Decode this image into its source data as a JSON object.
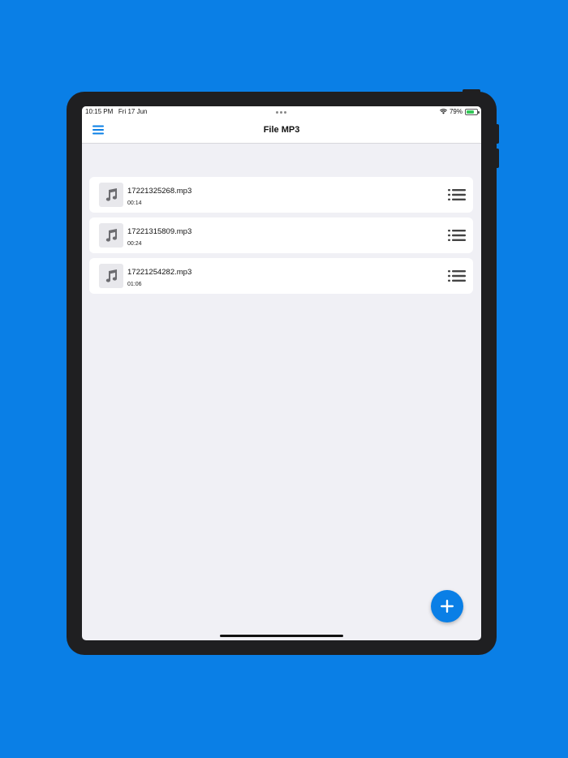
{
  "status_bar": {
    "time": "10:15 PM",
    "date": "Fri 17 Jun",
    "battery": "79%",
    "battery_level": 0.79
  },
  "nav": {
    "title": "File MP3",
    "menu_icon": "hamburger-icon"
  },
  "files": [
    {
      "name": "17221325268.mp3",
      "duration": "00:14"
    },
    {
      "name": "17221315809.mp3",
      "duration": "00:24"
    },
    {
      "name": "17221254282.mp3",
      "duration": "01:06"
    }
  ],
  "icons": {
    "file_thumb": "music-note-icon",
    "row_menu": "list-menu-icon",
    "fab": "plus-icon"
  },
  "colors": {
    "background": "#0a7fe6",
    "accent": "#0a7fe6",
    "device_frame": "#1f1f21",
    "screen_bg": "#f0f0f5"
  }
}
